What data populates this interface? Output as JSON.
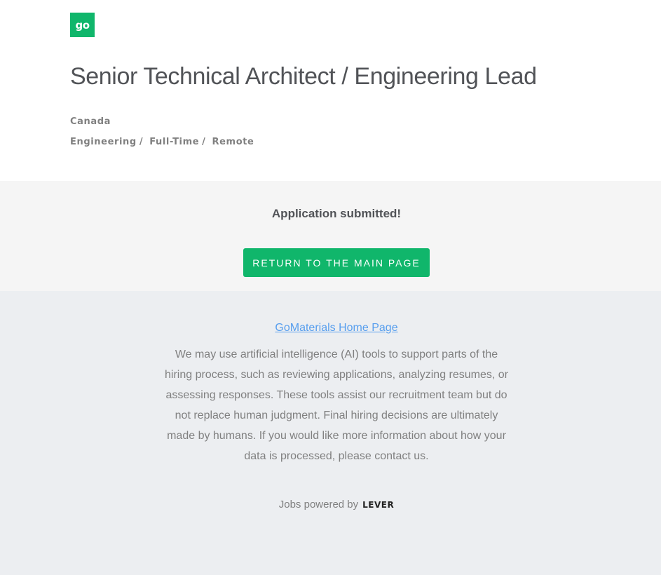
{
  "header": {
    "logo_text": "go",
    "logo_color": "#10b66b",
    "title": "Senior Technical Architect / Engineering Lead",
    "location": "Canada",
    "categories": {
      "team": "Engineering",
      "commitment": "Full-Time",
      "workplace": "Remote",
      "separator": "/"
    }
  },
  "confirmation": {
    "message": "Application submitted!",
    "return_button": "RETURN TO THE MAIN PAGE",
    "button_color": "#10b66b"
  },
  "footer": {
    "home_link": "GoMaterials Home Page",
    "ai_notice": "We may use artificial intelligence (AI) tools to support parts of the hiring process, such as reviewing applications, analyzing resumes, or assessing responses. These tools assist our recruitment team but do not replace human judgment. Final hiring decisions are ultimately made by humans. If you would like more information about how your data is processed, please contact us.",
    "powered_by": "Jobs powered by",
    "powered_brand": "LEVER"
  }
}
